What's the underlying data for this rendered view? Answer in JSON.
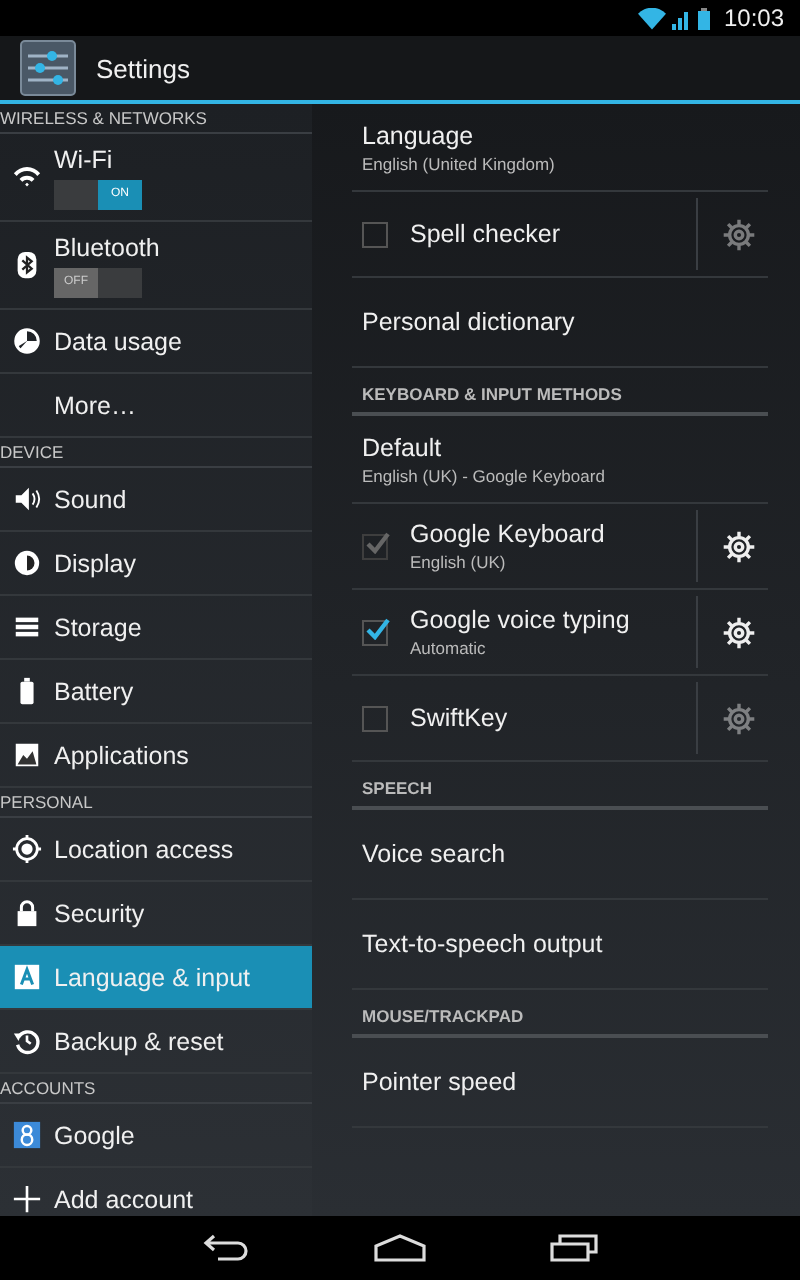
{
  "status_bar": {
    "time": "10:03"
  },
  "action_bar": {
    "title": "Settings"
  },
  "sidebar": {
    "sections": [
      {
        "header": "WIRELESS & NETWORKS",
        "items": [
          {
            "label": "Wi-Fi",
            "kind": "toggle",
            "on": true,
            "toggle_text": "ON",
            "selected": false
          },
          {
            "label": "Bluetooth",
            "kind": "toggle",
            "on": false,
            "toggle_text": "OFF",
            "selected": false
          },
          {
            "label": "Data usage",
            "kind": "plain",
            "selected": false
          },
          {
            "label": "More…",
            "kind": "plain",
            "selected": false
          }
        ]
      },
      {
        "header": "DEVICE",
        "items": [
          {
            "label": "Sound",
            "kind": "plain",
            "selected": false
          },
          {
            "label": "Display",
            "kind": "plain",
            "selected": false
          },
          {
            "label": "Storage",
            "kind": "plain",
            "selected": false
          },
          {
            "label": "Battery",
            "kind": "plain",
            "selected": false
          },
          {
            "label": "Applications",
            "kind": "plain",
            "selected": false
          }
        ]
      },
      {
        "header": "PERSONAL",
        "items": [
          {
            "label": "Location access",
            "kind": "plain",
            "selected": false
          },
          {
            "label": "Security",
            "kind": "plain",
            "selected": false
          },
          {
            "label": "Language & input",
            "kind": "plain",
            "selected": true
          },
          {
            "label": "Backup & reset",
            "kind": "plain",
            "selected": false
          }
        ]
      },
      {
        "header": "ACCOUNTS",
        "items": [
          {
            "label": "Google",
            "kind": "plain",
            "selected": false
          },
          {
            "label": "Add account",
            "kind": "plain",
            "selected": false
          }
        ]
      }
    ]
  },
  "detail": {
    "items": [
      {
        "kind": "two-line",
        "title": "Language",
        "summary": "English (United Kingdom)"
      },
      {
        "kind": "checkbox",
        "title": "Spell checker",
        "checked": false,
        "disabled": false
      },
      {
        "kind": "plain",
        "title": "Personal dictionary"
      },
      {
        "kind": "header",
        "title": "KEYBOARD & INPUT METHODS"
      },
      {
        "kind": "two-line",
        "title": "Default",
        "summary": "English (UK) - Google Keyboard"
      },
      {
        "kind": "checkbox",
        "title": "Google Keyboard",
        "summary": "English (UK)",
        "checked": true,
        "disabled": true
      },
      {
        "kind": "checkbox",
        "title": "Google voice typing",
        "summary": "Automatic",
        "checked": true,
        "disabled": false
      },
      {
        "kind": "checkbox",
        "title": "SwiftKey",
        "checked": false,
        "disabled": false
      },
      {
        "kind": "header",
        "title": "SPEECH"
      },
      {
        "kind": "plain",
        "title": "Voice search"
      },
      {
        "kind": "plain",
        "title": "Text-to-speech output"
      },
      {
        "kind": "header",
        "title": "MOUSE/TRACKPAD"
      },
      {
        "kind": "plain",
        "title": "Pointer speed"
      }
    ]
  }
}
